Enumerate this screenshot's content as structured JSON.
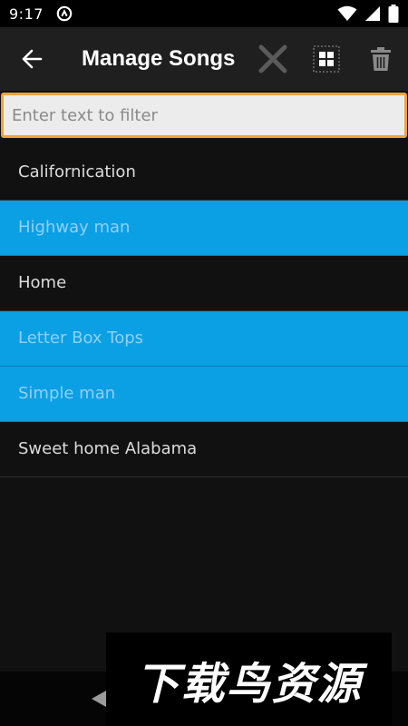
{
  "status_bar": {
    "time": "9:17"
  },
  "app_bar": {
    "title": "Manage Songs"
  },
  "filter": {
    "placeholder": "Enter text to filter",
    "value": ""
  },
  "songs": [
    {
      "title": "Californication",
      "selected": false
    },
    {
      "title": "Highway man",
      "selected": true
    },
    {
      "title": "Home",
      "selected": false
    },
    {
      "title": "Letter Box Tops",
      "selected": true
    },
    {
      "title": "Simple man",
      "selected": true
    },
    {
      "title": "Sweet home Alabama",
      "selected": false
    }
  ],
  "watermark": {
    "text": "下载鸟资源"
  },
  "colors": {
    "selected_row": "#0b9fe4",
    "filter_border": "#f2a23a",
    "app_bar": "#1f1f1f"
  }
}
